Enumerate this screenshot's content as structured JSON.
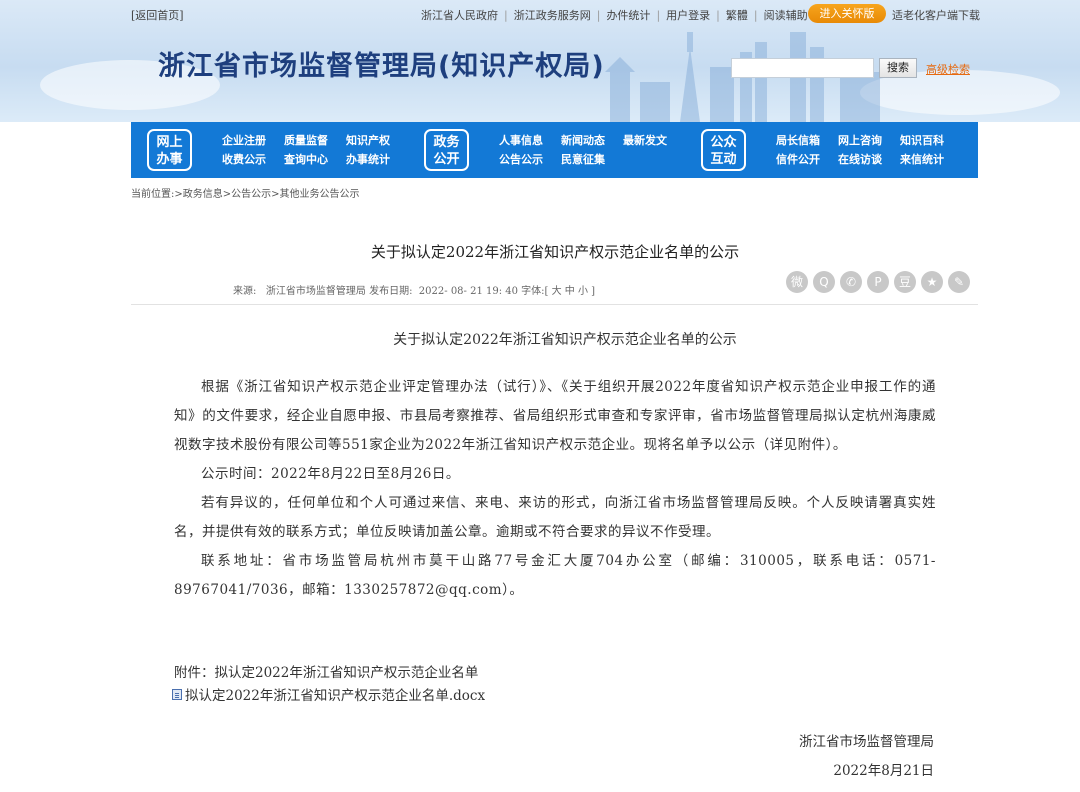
{
  "topbar": {
    "back": "[返回首页]",
    "links": [
      "浙江省人民政府",
      "浙江政务服务网",
      "办件统计",
      "用户登录",
      "繁體",
      "阅读辅助"
    ],
    "care_button": "进入关怀版",
    "old_download": "适老化客户端下载"
  },
  "site_title": "浙江省市场监督管理局(知识产权局)",
  "search": {
    "button": "搜索",
    "advanced": "高级检索"
  },
  "nav": {
    "blocks": [
      {
        "label": "网上\n办事",
        "row1": [
          "企业注册",
          "质量监督",
          "知识产权"
        ],
        "row2": [
          "收费公示",
          "查询中心",
          "办事统计"
        ]
      },
      {
        "label": "政务\n公开",
        "row1": [
          "人事信息",
          "新闻动态",
          "最新发文"
        ],
        "row2": [
          "公告公示",
          "民意征集"
        ]
      },
      {
        "label": "公众\n互动",
        "row1": [
          "局长信箱",
          "网上咨询",
          "知识百科"
        ],
        "row2": [
          "信件公开",
          "在线访谈",
          "来信统计"
        ]
      }
    ]
  },
  "breadcrumb": "当前位置:>政务信息>公告公示>其他业务公告公示",
  "article": {
    "title": "关于拟认定2022年浙江省知识产权示范企业名单的公示",
    "meta": "来源:   浙江省市场监督管理局 发布日期:  2022- 08- 21 19: 40 字体:[ 大 中 小 ]",
    "subtitle": "关于拟认定2022年浙江省知识产权示范企业名单的公示",
    "paragraphs": [
      "根据《浙江省知识产权示范企业评定管理办法（试行）》、《关于组织开展2022年度省知识产权示范企业申报工作的通知》的文件要求，经企业自愿申报、市县局考察推荐、省局组织形式审查和专家评审，省市场监督管理局拟认定杭州海康威视数字技术股份有限公司等551家企业为2022年浙江省知识产权示范企业。现将名单予以公示（详见附件）。",
      "公示时间：2022年8月22日至8月26日。",
      "若有异议的，任何单位和个人可通过来信、来电、来访的形式，向浙江省市场监督管理局反映。个人反映请署真实姓名，并提供有效的联系方式；单位反映请加盖公章。逾期或不符合要求的异议不作受理。",
      "联系地址：省市场监管局杭州市莫干山路77号金汇大厦704办公室（邮编：310005，联系电话：0571-89767041/7036，邮箱：1330257872@qq.com）。"
    ],
    "attachment_label": "附件：拟认定2022年浙江省知识产权示范企业名单",
    "attachment_file": "拟认定2022年浙江省知识产权示范企业名单.docx",
    "signature": "浙江省市场监督管理局",
    "date": "2022年8月21日"
  },
  "share_icons": [
    "weibo-icon",
    "qq-icon",
    "wechat-icon",
    "pinterest-icon",
    "douban-icon",
    "star-icon",
    "more-icon"
  ]
}
